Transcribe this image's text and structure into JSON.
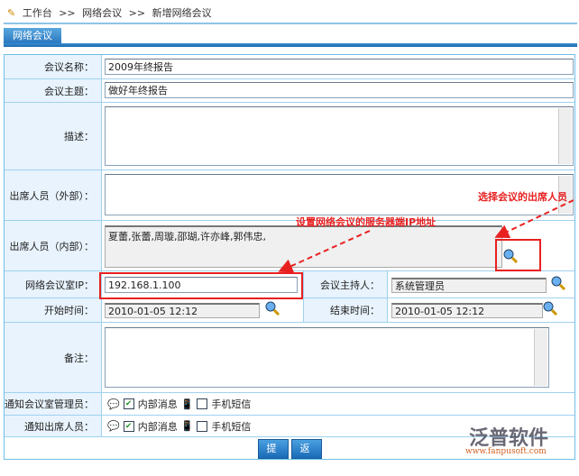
{
  "breadcrumb": {
    "items": [
      "工作台",
      ">>",
      "网络会议",
      ">>",
      "新增网络会议"
    ]
  },
  "tab": {
    "label": "网络会议"
  },
  "form": {
    "name_label": "会议名称：",
    "name_value": "2009年终报告",
    "topic_label": "会议主题：",
    "topic_value": "做好年终报告",
    "desc_label": "描述：",
    "external_label": "出席人员（外部）：",
    "internal_label": "出席人员（内部）：",
    "internal_value": "夏蕾,张蕾,周璇,邵瑚,许亦峰,郭伟忠,",
    "ip_label": "网络会议室IP：",
    "ip_value": "192.168.1.100",
    "host_label": "会议主持人：",
    "host_value": "系统管理员",
    "start_label": "开始时间：",
    "start_value": "2010-01-05 12:12",
    "end_label": "结束时间：",
    "end_value": "2010-01-05 12:12",
    "remark_label": "备注：",
    "notify_admin_label": "通知会议室管理员：",
    "notify_attendee_label": "通知出席人员：",
    "internal_msg": "内部消息",
    "sms": "手机短信",
    "submit": "提 交",
    "back": "返 回"
  },
  "annotations": {
    "attendee_note": "选择会议的出席人员",
    "ip_note": "设置网络会议的服务器端IP地址"
  },
  "watermark": {
    "brand": "泛普软件",
    "url": "www.fanpusoft.com"
  }
}
